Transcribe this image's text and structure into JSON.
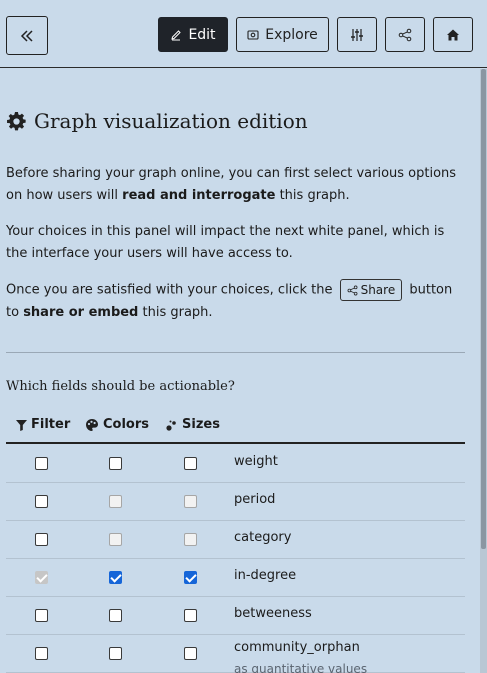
{
  "topbar": {
    "back_icon": "double-chevron-left-icon",
    "edit_label": "Edit",
    "explore_label": "Explore",
    "settings_icon": "sliders-icon",
    "share_icon": "share-icon",
    "home_icon": "home-icon"
  },
  "panel": {
    "title": "Graph visualization edition",
    "intro_1_a": "Before sharing your graph online, you can first select various options on how users will ",
    "intro_1_b": "read and interrogate",
    "intro_1_c": " this graph.",
    "intro_2": "Your choices in this panel will impact the next white panel, which is the interface your users will have access to.",
    "intro_3_a": "Once you are satisfied with your choices, click the ",
    "intro_3_share": "Share",
    "intro_3_b": " button to ",
    "intro_3_c": "share or embed",
    "intro_3_d": " this graph.",
    "question": "Which fields should be actionable?",
    "columns": {
      "filter": "Filter",
      "colors": "Colors",
      "sizes": "Sizes"
    },
    "fields": [
      {
        "name": "weight",
        "sub": "",
        "filter": false,
        "filter_disabled": false,
        "colors": false,
        "colors_disabled": false,
        "sizes": false,
        "sizes_disabled": false
      },
      {
        "name": "period",
        "sub": "",
        "filter": false,
        "filter_disabled": false,
        "colors": false,
        "colors_disabled": true,
        "sizes": false,
        "sizes_disabled": true
      },
      {
        "name": "category",
        "sub": "",
        "filter": false,
        "filter_disabled": false,
        "colors": false,
        "colors_disabled": true,
        "sizes": false,
        "sizes_disabled": true
      },
      {
        "name": "in-degree",
        "sub": "",
        "filter": true,
        "filter_disabled": true,
        "colors": true,
        "colors_disabled": false,
        "sizes": true,
        "sizes_disabled": false
      },
      {
        "name": "betweeness",
        "sub": "",
        "filter": false,
        "filter_disabled": false,
        "colors": false,
        "colors_disabled": false,
        "sizes": false,
        "sizes_disabled": false
      },
      {
        "name": "community_orphan",
        "sub": "as quantitative values",
        "filter": false,
        "filter_disabled": false,
        "colors": false,
        "colors_disabled": false,
        "sizes": false,
        "sizes_disabled": false
      }
    ]
  },
  "colors": {
    "background": "#c9daea",
    "accent": "#1565d8",
    "dark_button": "#1f2329"
  }
}
